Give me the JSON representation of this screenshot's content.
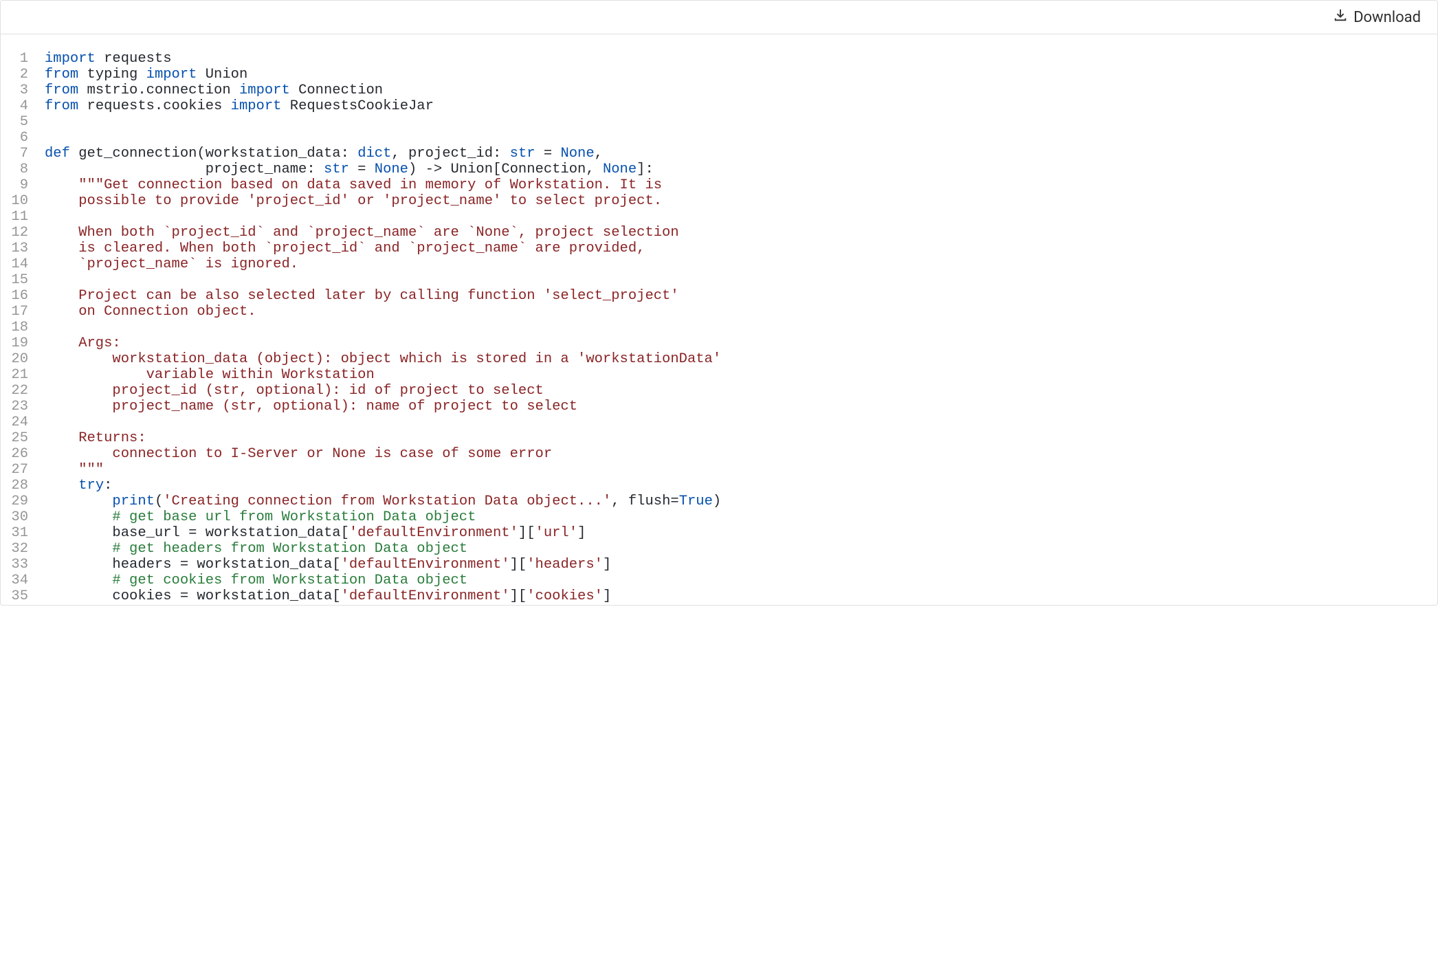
{
  "toolbar": {
    "download_label": "Download"
  },
  "code": {
    "lines": [
      {
        "n": 1,
        "tokens": [
          [
            "kw",
            "import"
          ],
          [
            "txt",
            " requests"
          ]
        ]
      },
      {
        "n": 2,
        "tokens": [
          [
            "kw",
            "from"
          ],
          [
            "txt",
            " typing "
          ],
          [
            "kw",
            "import"
          ],
          [
            "txt",
            " Union"
          ]
        ]
      },
      {
        "n": 3,
        "tokens": [
          [
            "kw",
            "from"
          ],
          [
            "txt",
            " mstrio.connection "
          ],
          [
            "kw",
            "import"
          ],
          [
            "txt",
            " Connection"
          ]
        ]
      },
      {
        "n": 4,
        "tokens": [
          [
            "kw",
            "from"
          ],
          [
            "txt",
            " requests.cookies "
          ],
          [
            "kw",
            "import"
          ],
          [
            "txt",
            " RequestsCookieJar"
          ]
        ]
      },
      {
        "n": 5,
        "tokens": [
          [
            "txt",
            ""
          ]
        ]
      },
      {
        "n": 6,
        "tokens": [
          [
            "txt",
            ""
          ]
        ]
      },
      {
        "n": 7,
        "tokens": [
          [
            "kw",
            "def"
          ],
          [
            "txt",
            " get_connection(workstation_data: "
          ],
          [
            "kw",
            "dict"
          ],
          [
            "txt",
            ", project_id: "
          ],
          [
            "kw",
            "str"
          ],
          [
            "txt",
            " = "
          ],
          [
            "kw",
            "None"
          ],
          [
            "txt",
            ","
          ]
        ]
      },
      {
        "n": 8,
        "tokens": [
          [
            "txt",
            "                   project_name: "
          ],
          [
            "kw",
            "str"
          ],
          [
            "txt",
            " = "
          ],
          [
            "kw",
            "None"
          ],
          [
            "txt",
            ") -> Union[Connection, "
          ],
          [
            "kw",
            "None"
          ],
          [
            "txt",
            "]:"
          ]
        ]
      },
      {
        "n": 9,
        "tokens": [
          [
            "txt",
            "    "
          ],
          [
            "str",
            "\"\"\"Get connection based on data saved in memory of Workstation. It is"
          ]
        ]
      },
      {
        "n": 10,
        "tokens": [
          [
            "str",
            "    possible to provide 'project_id' or 'project_name' to select project."
          ]
        ]
      },
      {
        "n": 11,
        "tokens": [
          [
            "str",
            ""
          ]
        ]
      },
      {
        "n": 12,
        "tokens": [
          [
            "str",
            "    When both `project_id` and `project_name` are `None`, project selection"
          ]
        ]
      },
      {
        "n": 13,
        "tokens": [
          [
            "str",
            "    is cleared. When both `project_id` and `project_name` are provided,"
          ]
        ]
      },
      {
        "n": 14,
        "tokens": [
          [
            "str",
            "    `project_name` is ignored."
          ]
        ]
      },
      {
        "n": 15,
        "tokens": [
          [
            "str",
            ""
          ]
        ]
      },
      {
        "n": 16,
        "tokens": [
          [
            "str",
            "    Project can be also selected later by calling function 'select_project'"
          ]
        ]
      },
      {
        "n": 17,
        "tokens": [
          [
            "str",
            "    on Connection object."
          ]
        ]
      },
      {
        "n": 18,
        "tokens": [
          [
            "str",
            ""
          ]
        ]
      },
      {
        "n": 19,
        "tokens": [
          [
            "str",
            "    Args:"
          ]
        ]
      },
      {
        "n": 20,
        "tokens": [
          [
            "str",
            "        workstation_data (object): object which is stored in a 'workstationData'"
          ]
        ]
      },
      {
        "n": 21,
        "tokens": [
          [
            "str",
            "            variable within Workstation"
          ]
        ]
      },
      {
        "n": 22,
        "tokens": [
          [
            "str",
            "        project_id (str, optional): id of project to select"
          ]
        ]
      },
      {
        "n": 23,
        "tokens": [
          [
            "str",
            "        project_name (str, optional): name of project to select"
          ]
        ]
      },
      {
        "n": 24,
        "tokens": [
          [
            "str",
            ""
          ]
        ]
      },
      {
        "n": 25,
        "tokens": [
          [
            "str",
            "    Returns:"
          ]
        ]
      },
      {
        "n": 26,
        "tokens": [
          [
            "str",
            "        connection to I-Server or None is case of some error"
          ]
        ]
      },
      {
        "n": 27,
        "tokens": [
          [
            "str",
            "    \"\"\""
          ]
        ]
      },
      {
        "n": 28,
        "tokens": [
          [
            "txt",
            "    "
          ],
          [
            "kw",
            "try"
          ],
          [
            "txt",
            ":"
          ]
        ]
      },
      {
        "n": 29,
        "tokens": [
          [
            "txt",
            "        "
          ],
          [
            "kw",
            "print"
          ],
          [
            "txt",
            "("
          ],
          [
            "str",
            "'Creating connection from Workstation Data object...'"
          ],
          [
            "txt",
            ", flush="
          ],
          [
            "kw",
            "True"
          ],
          [
            "txt",
            ")"
          ]
        ]
      },
      {
        "n": 30,
        "tokens": [
          [
            "txt",
            "        "
          ],
          [
            "cmt",
            "# get base url from Workstation Data object"
          ]
        ]
      },
      {
        "n": 31,
        "tokens": [
          [
            "txt",
            "        base_url = workstation_data["
          ],
          [
            "str",
            "'defaultEnvironment'"
          ],
          [
            "txt",
            "]["
          ],
          [
            "str",
            "'url'"
          ],
          [
            "txt",
            "]"
          ]
        ]
      },
      {
        "n": 32,
        "tokens": [
          [
            "txt",
            "        "
          ],
          [
            "cmt",
            "# get headers from Workstation Data object"
          ]
        ]
      },
      {
        "n": 33,
        "tokens": [
          [
            "txt",
            "        headers = workstation_data["
          ],
          [
            "str",
            "'defaultEnvironment'"
          ],
          [
            "txt",
            "]["
          ],
          [
            "str",
            "'headers'"
          ],
          [
            "txt",
            "]"
          ]
        ]
      },
      {
        "n": 34,
        "tokens": [
          [
            "txt",
            "        "
          ],
          [
            "cmt",
            "# get cookies from Workstation Data object"
          ]
        ]
      },
      {
        "n": 35,
        "tokens": [
          [
            "txt",
            "        cookies = workstation_data["
          ],
          [
            "str",
            "'defaultEnvironment'"
          ],
          [
            "txt",
            "]["
          ],
          [
            "str",
            "'cookies'"
          ],
          [
            "txt",
            "]"
          ]
        ]
      }
    ]
  }
}
